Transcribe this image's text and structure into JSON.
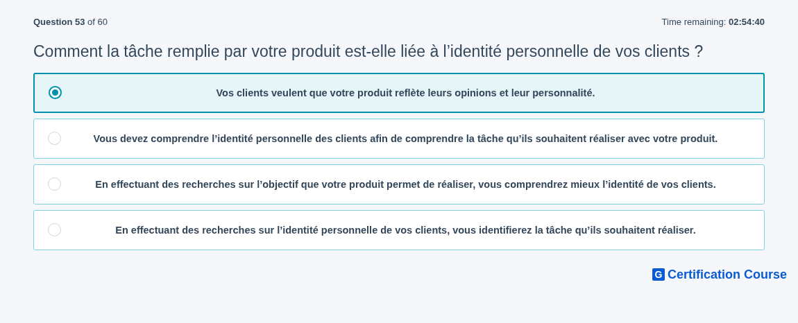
{
  "progress": {
    "label": "Question 53",
    "total": "of 60"
  },
  "timer": {
    "label": "Time remaining:",
    "value": "02:54:40"
  },
  "question": "Comment la tâche remplie par votre produit est-elle liée à l’identité personnelle de vos clients ?",
  "options": [
    {
      "text": "Vos clients veulent que votre produit reflète leurs opinions et leur personnalité.",
      "selected": true
    },
    {
      "text": "Vous devez comprendre l’identité personnelle des clients afin de comprendre la tâche qu’ils souhaitent réaliser avec votre produit.",
      "selected": false
    },
    {
      "text": "En effectuant des recherches sur l’objectif que votre produit permet de réaliser, vous comprendrez mieux l’identité de vos clients.",
      "selected": false
    },
    {
      "text": "En effectuant des recherches sur l’identité personnelle de vos clients, vous identifierez la tâche qu’ils souhaitent réaliser.",
      "selected": false
    }
  ],
  "brand": {
    "letter": "G",
    "name": "Certification Course"
  }
}
